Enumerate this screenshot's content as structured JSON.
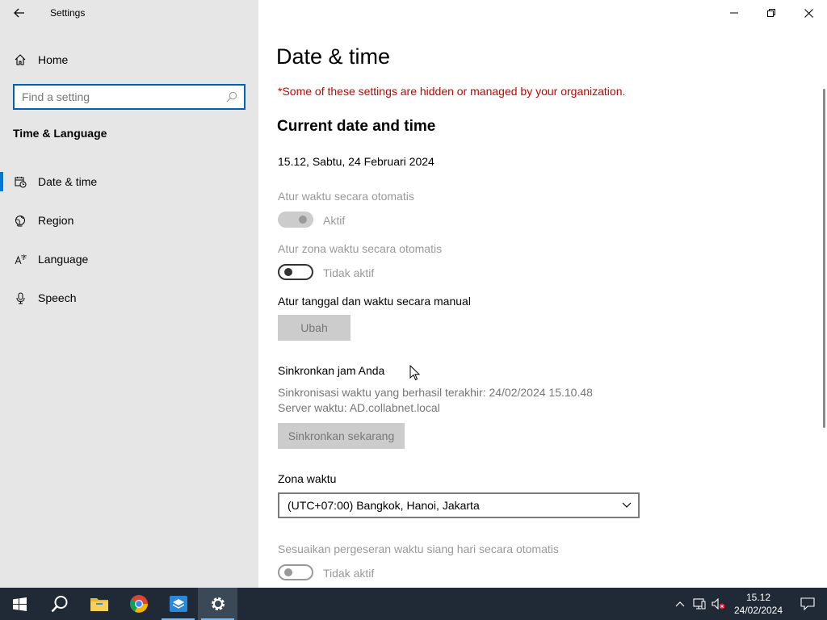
{
  "window": {
    "title": "Settings"
  },
  "sidebar": {
    "home_label": "Home",
    "search_placeholder": "Find a setting",
    "section_title": "Time & Language",
    "items": [
      {
        "label": "Date & time",
        "icon": "calendar-clock-icon",
        "active": true
      },
      {
        "label": "Region",
        "icon": "globe-icon",
        "active": false
      },
      {
        "label": "Language",
        "icon": "language-icon",
        "active": false
      },
      {
        "label": "Speech",
        "icon": "microphone-icon",
        "active": false
      }
    ]
  },
  "main": {
    "page_title": "Date & time",
    "org_notice": "*Some of these settings are hidden or managed by your organization.",
    "current_section_title": "Current date and time",
    "current_date": "15.12, Sabtu, 24 Februari 2024",
    "auto_time": {
      "label": "Atur waktu secara otomatis",
      "state_text": "Aktif",
      "on": true,
      "disabled": true
    },
    "auto_timezone": {
      "label": "Atur zona waktu secara otomatis",
      "state_text": "Tidak aktif",
      "on": false,
      "disabled": true
    },
    "manual": {
      "label": "Atur tanggal dan waktu secara manual",
      "button_label": "Ubah"
    },
    "sync": {
      "label": "Sinkronkan jam Anda",
      "last_sync": "Sinkronisasi waktu yang berhasil terakhir: 24/02/2024 15.10.48",
      "server": "Server waktu: AD.collabnet.local",
      "button_label": "Sinkronkan sekarang"
    },
    "timezone": {
      "label": "Zona waktu",
      "selected": "(UTC+07:00) Bangkok, Hanoi, Jakarta"
    },
    "dst": {
      "label": "Sesuaikan pergeseran waktu siang hari secara otomatis",
      "state_text": "Tidak aktif",
      "on": false,
      "disabled": true
    }
  },
  "taskbar": {
    "apps": [
      "start-icon",
      "search-icon",
      "file-explorer-icon",
      "chrome-icon",
      "remote-desktop-icon",
      "settings-icon"
    ],
    "clock_time": "15.12",
    "clock_date": "24/02/2024"
  },
  "colors": {
    "sidebar_bg": "#e6e6e6",
    "accent": "#0078d7",
    "warning": "#c50500",
    "taskbar_bg": "#1f2a36"
  }
}
